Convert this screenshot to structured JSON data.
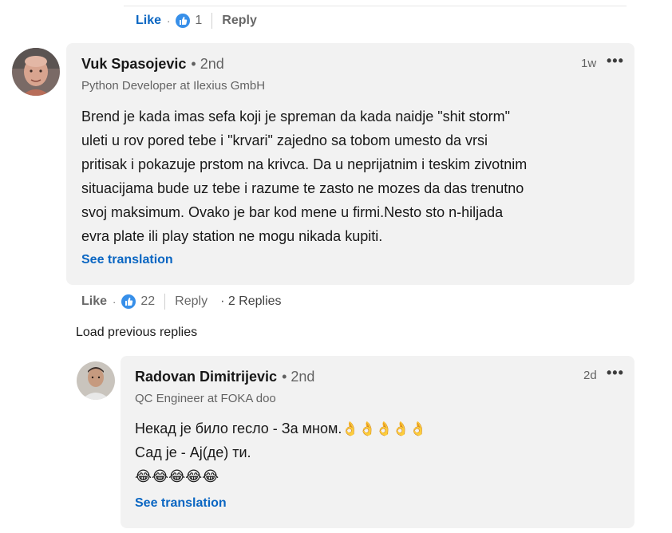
{
  "top_actions": {
    "like_label": "Like",
    "separator": "·",
    "reaction_count": "1",
    "reply_label": "Reply"
  },
  "comment": {
    "author": "Vuk Spasojevic",
    "degree": "• 2nd",
    "headline": "Python Developer at Ilexius GmbH",
    "time": "1w",
    "more": "•••",
    "body_lines": [
      "Brend je kada imas sefa koji je spreman da kada naidje \"shit storm\"",
      "uleti u rov pored tebe i \"krvari\" zajedno sa tobom umesto da vrsi",
      "pritisak i pokazuje prstom na krivca. Da u neprijatnim i teskim zivotnim",
      "situacijama bude uz tebe i razume te zasto ne mozes da das trenutno",
      "svoj maksimum. Ovako je bar kod mene u firmi.Nesto sto n-hiljada",
      "evra plate ili play station ne mogu nikada kupiti."
    ],
    "see_translation": "See translation",
    "actions": {
      "like_label": "Like",
      "separator": "·",
      "reaction_count": "22",
      "reply_label": "Reply",
      "replies_label": "· 2 Replies"
    }
  },
  "load_previous": "Load previous replies",
  "reply": {
    "author": "Radovan Dimitrijevic",
    "degree": "• 2nd",
    "headline": "QC Engineer at FOKA doo",
    "time": "2d",
    "more": "•••",
    "line1": "Некад је било гесло - За мном.",
    "line1_emoji": "👌👌👌👌👌",
    "line2": "Сад је - Ај(де) ти.",
    "line3_emoji": "😂😂😂😂😂",
    "see_translation": "See translation"
  },
  "colors": {
    "link_blue": "#0a66c2",
    "reaction_blue": "#378fe9",
    "bubble_bg": "#f2f2f2"
  }
}
